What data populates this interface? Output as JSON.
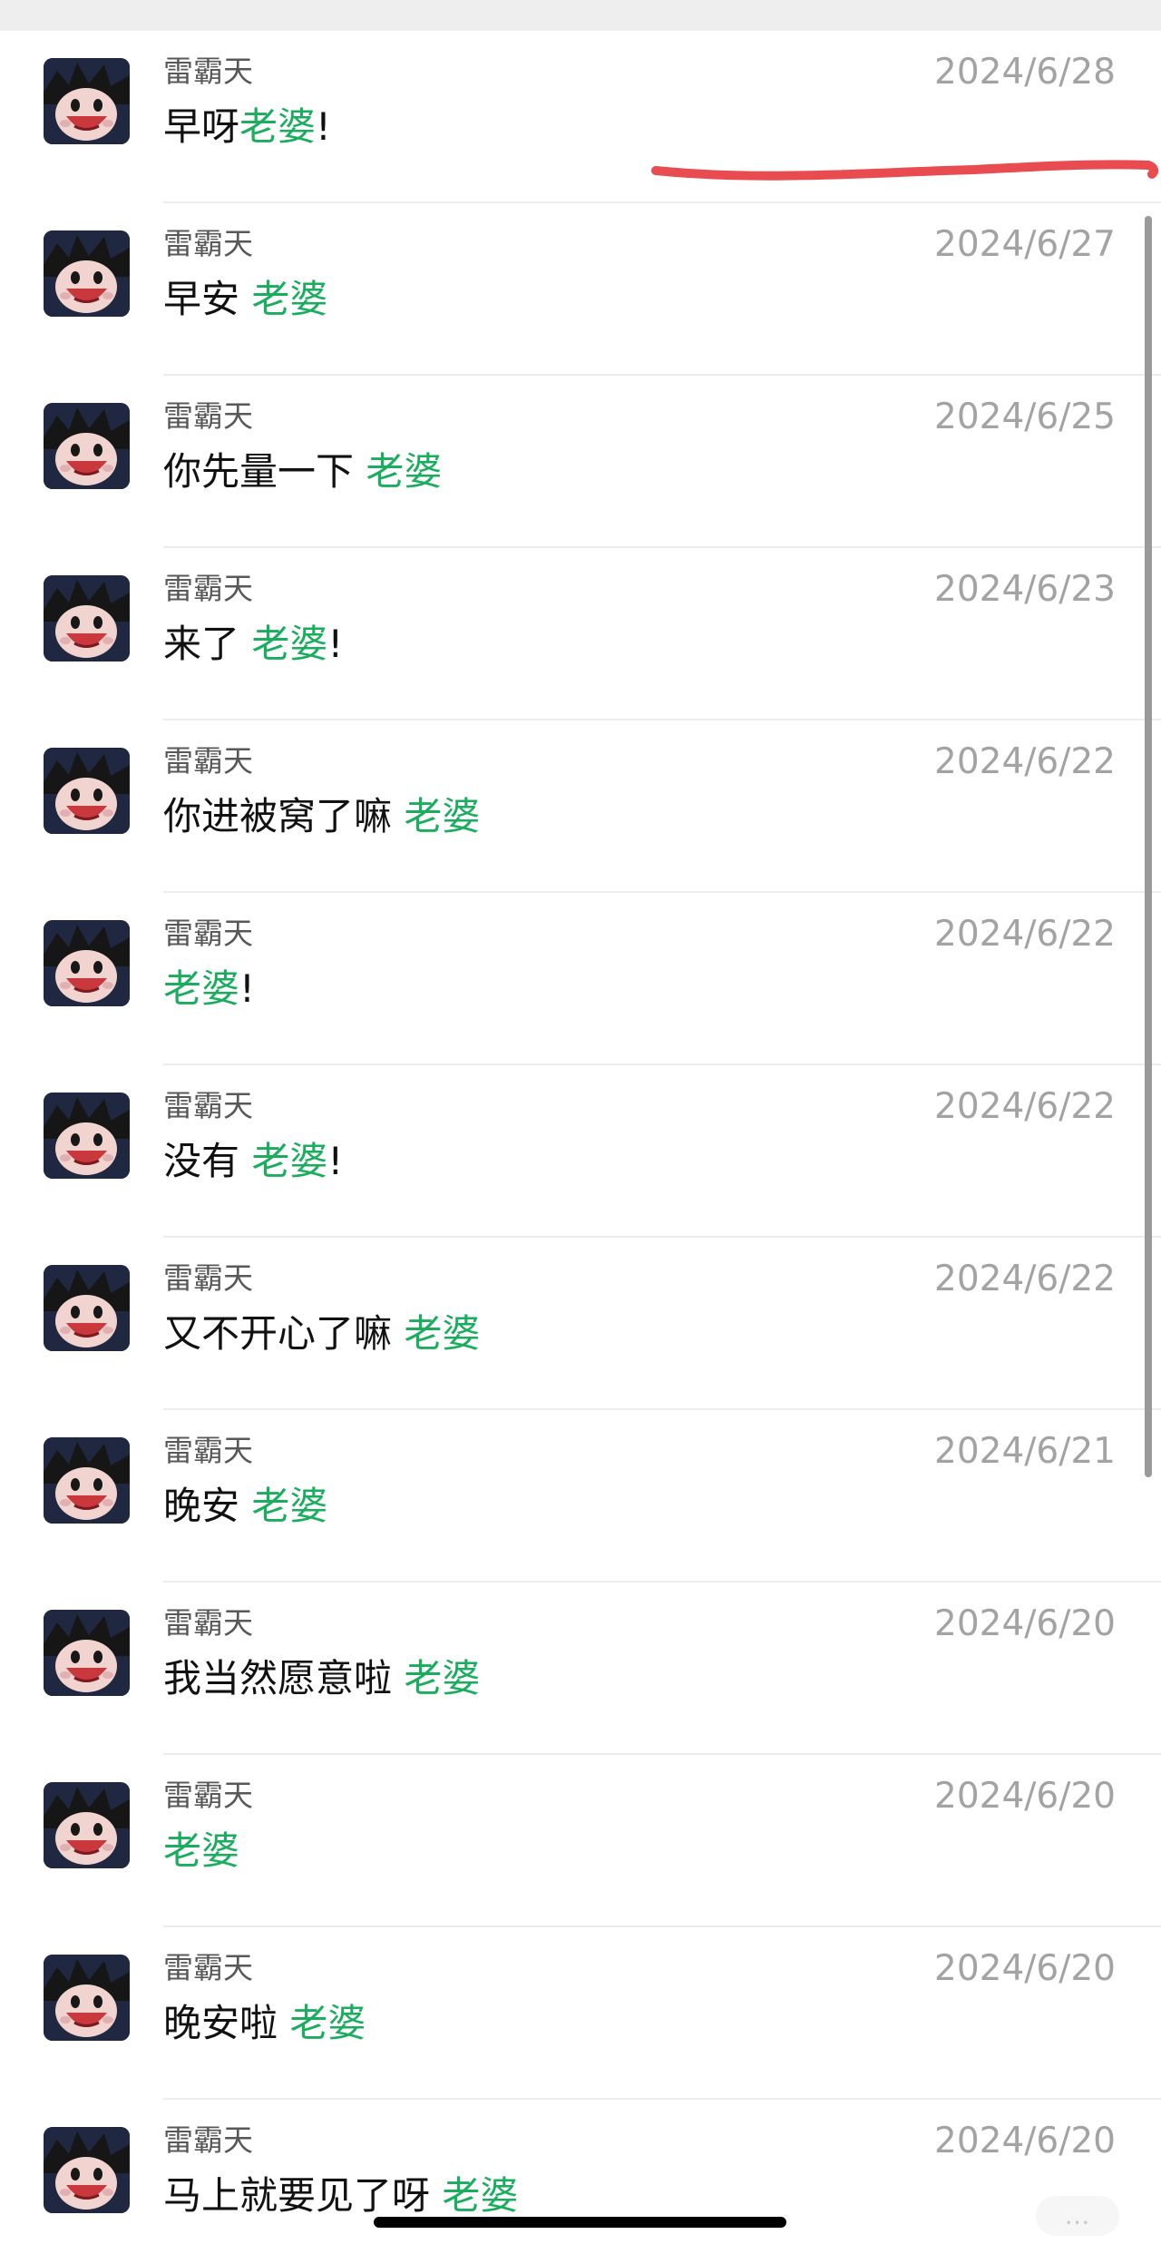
{
  "results": [
    {
      "sender": "雷霸天",
      "date": "2024/6/28",
      "before": "早呀",
      "keyword": "老婆",
      "after": "!"
    },
    {
      "sender": "雷霸天",
      "date": "2024/6/27",
      "before": "早安 ",
      "keyword": "老婆",
      "after": ""
    },
    {
      "sender": "雷霸天",
      "date": "2024/6/25",
      "before": "你先量一下 ",
      "keyword": "老婆",
      "after": ""
    },
    {
      "sender": "雷霸天",
      "date": "2024/6/23",
      "before": "来了 ",
      "keyword": "老婆",
      "after": "!"
    },
    {
      "sender": "雷霸天",
      "date": "2024/6/22",
      "before": "你进被窝了嘛 ",
      "keyword": "老婆",
      "after": ""
    },
    {
      "sender": "雷霸天",
      "date": "2024/6/22",
      "before": "",
      "keyword": "老婆",
      "after": "!"
    },
    {
      "sender": "雷霸天",
      "date": "2024/6/22",
      "before": "没有 ",
      "keyword": "老婆",
      "after": "!"
    },
    {
      "sender": "雷霸天",
      "date": "2024/6/22",
      "before": "又不开心了嘛 ",
      "keyword": "老婆",
      "after": ""
    },
    {
      "sender": "雷霸天",
      "date": "2024/6/21",
      "before": "晚安 ",
      "keyword": "老婆",
      "after": ""
    },
    {
      "sender": "雷霸天",
      "date": "2024/6/20",
      "before": "我当然愿意啦 ",
      "keyword": "老婆",
      "after": ""
    },
    {
      "sender": "雷霸天",
      "date": "2024/6/20",
      "before": "",
      "keyword": "老婆",
      "after": ""
    },
    {
      "sender": "雷霸天",
      "date": "2024/6/20",
      "before": "晚安啦 ",
      "keyword": "老婆",
      "after": ""
    },
    {
      "sender": "雷霸天",
      "date": "2024/6/20",
      "before": "马上就要见了呀 ",
      "keyword": "老婆",
      "after": ""
    }
  ],
  "watermark": "…",
  "colors": {
    "keyword": "#1aad5d",
    "annotation": "#e84b50",
    "date": "#a3a3a3"
  }
}
